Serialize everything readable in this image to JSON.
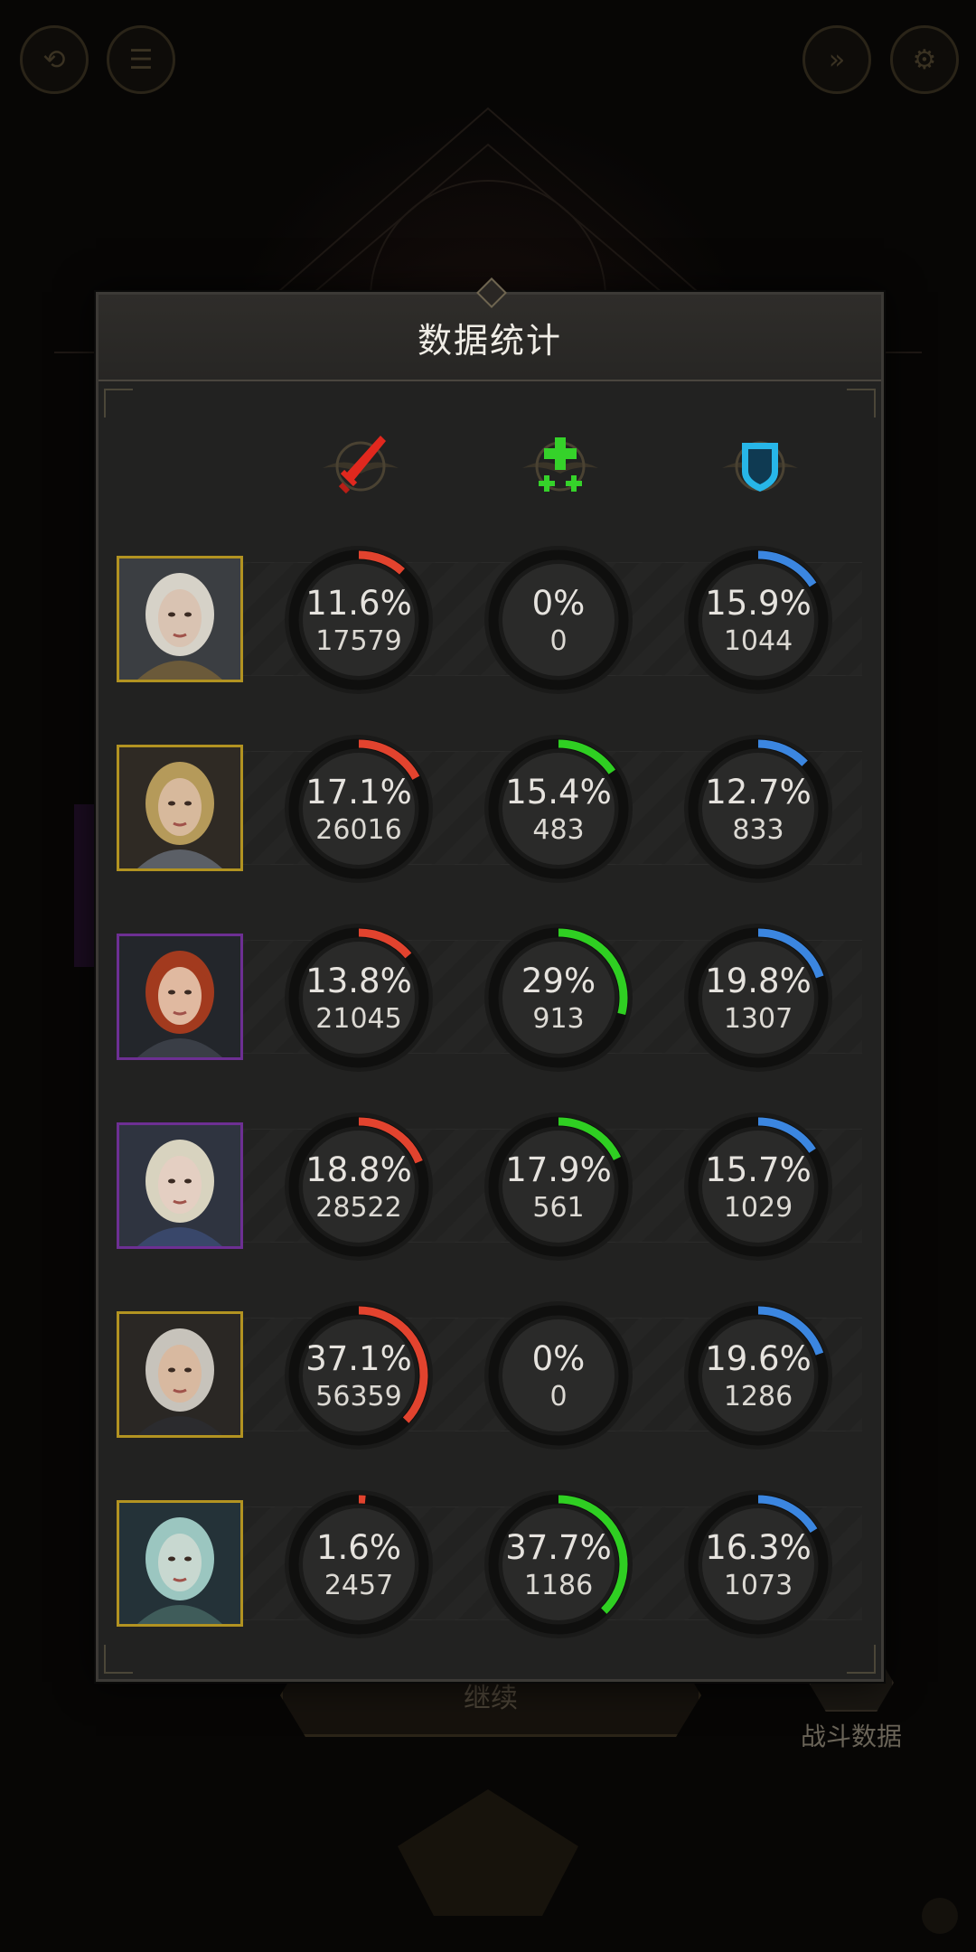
{
  "background": {
    "continue_label": "继续",
    "battle_data_label": "战斗数据"
  },
  "modal": {
    "title": "数据统计",
    "columns": [
      {
        "icon": "sword-icon",
        "color": "#e03a2c"
      },
      {
        "icon": "heal-plus-icon",
        "color": "#3fce2c"
      },
      {
        "icon": "shield-icon",
        "color": "#27b6e8"
      }
    ],
    "ring_colors": {
      "damage": "#e2432e",
      "heal": "#2fcf22",
      "tank": "#3b86e0"
    },
    "heroes": [
      {
        "portrait": "white-haired-woman-portrait",
        "frame": "gold",
        "damage": {
          "pct": "11.6%",
          "value": "17579",
          "ratio": 0.116
        },
        "heal": {
          "pct": "0%",
          "value": "0",
          "ratio": 0
        },
        "tank": {
          "pct": "15.9%",
          "value": "1044",
          "ratio": 0.159
        }
      },
      {
        "portrait": "blonde-eyepatch-portrait",
        "frame": "gold",
        "damage": {
          "pct": "17.1%",
          "value": "26016",
          "ratio": 0.171
        },
        "heal": {
          "pct": "15.4%",
          "value": "483",
          "ratio": 0.154
        },
        "tank": {
          "pct": "12.7%",
          "value": "833",
          "ratio": 0.127
        }
      },
      {
        "portrait": "hooded-red-hair-portrait",
        "frame": "purple",
        "damage": {
          "pct": "13.8%",
          "value": "21045",
          "ratio": 0.138
        },
        "heal": {
          "pct": "29%",
          "value": "913",
          "ratio": 0.29
        },
        "tank": {
          "pct": "19.8%",
          "value": "1307",
          "ratio": 0.198
        }
      },
      {
        "portrait": "elf-hood-portrait",
        "frame": "purple",
        "damage": {
          "pct": "18.8%",
          "value": "28522",
          "ratio": 0.188
        },
        "heal": {
          "pct": "17.9%",
          "value": "561",
          "ratio": 0.179
        },
        "tank": {
          "pct": "15.7%",
          "value": "1029",
          "ratio": 0.157
        }
      },
      {
        "portrait": "silver-haired-man-portrait",
        "frame": "gold",
        "damage": {
          "pct": "37.1%",
          "value": "56359",
          "ratio": 0.371
        },
        "heal": {
          "pct": "0%",
          "value": "0",
          "ratio": 0
        },
        "tank": {
          "pct": "19.6%",
          "value": "1286",
          "ratio": 0.196
        }
      },
      {
        "portrait": "green-elf-portrait",
        "frame": "gold",
        "damage": {
          "pct": "1.6%",
          "value": "2457",
          "ratio": 0.016
        },
        "heal": {
          "pct": "37.7%",
          "value": "1186",
          "ratio": 0.377
        },
        "tank": {
          "pct": "16.3%",
          "value": "1073",
          "ratio": 0.163
        }
      }
    ]
  }
}
